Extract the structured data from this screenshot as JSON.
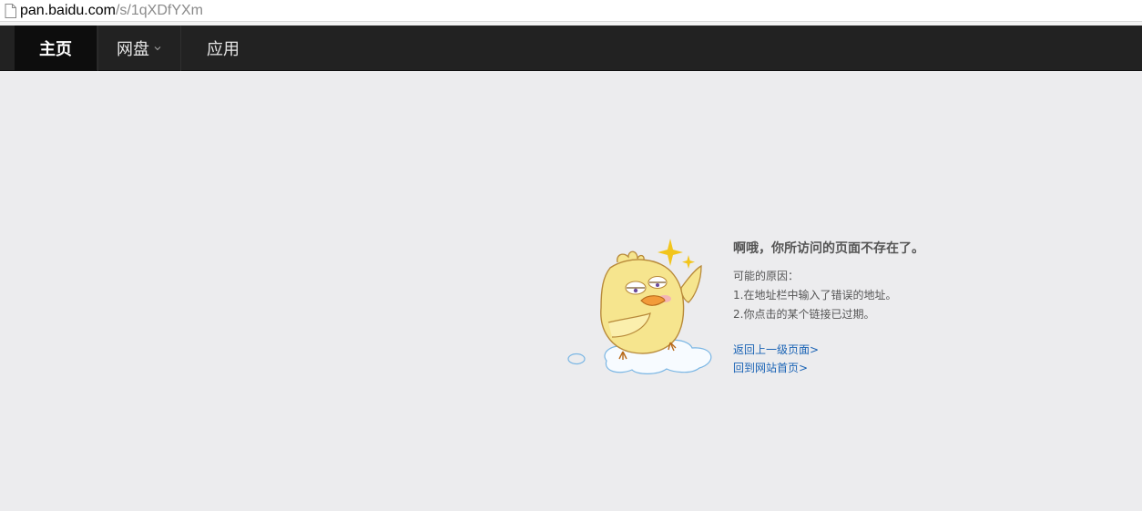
{
  "browser": {
    "url_host": "pan.baidu.com",
    "url_path": "/s/1qXDfYXm",
    "page_icon": "document-icon"
  },
  "nav": {
    "items": [
      {
        "label": "主页",
        "active": true
      },
      {
        "label": "网盘",
        "has_dropdown": true
      },
      {
        "label": "应用"
      }
    ]
  },
  "error": {
    "title": "啊哦，你所访问的页面不存在了。",
    "reasons_heading": "可能的原因：",
    "reasons": [
      "1.在地址栏中输入了错误的地址。",
      "2.你点击的某个链接已过期。"
    ],
    "links": {
      "back": "返回上一级页面>",
      "home": "回到网站首页>"
    },
    "mascot_icon": "confused-chick-icon"
  },
  "colors": {
    "nav_bg": "#222222",
    "nav_active_bg": "#0d0d0d",
    "content_bg": "#ececee",
    "link": "#1a63b5",
    "text": "#555555"
  }
}
